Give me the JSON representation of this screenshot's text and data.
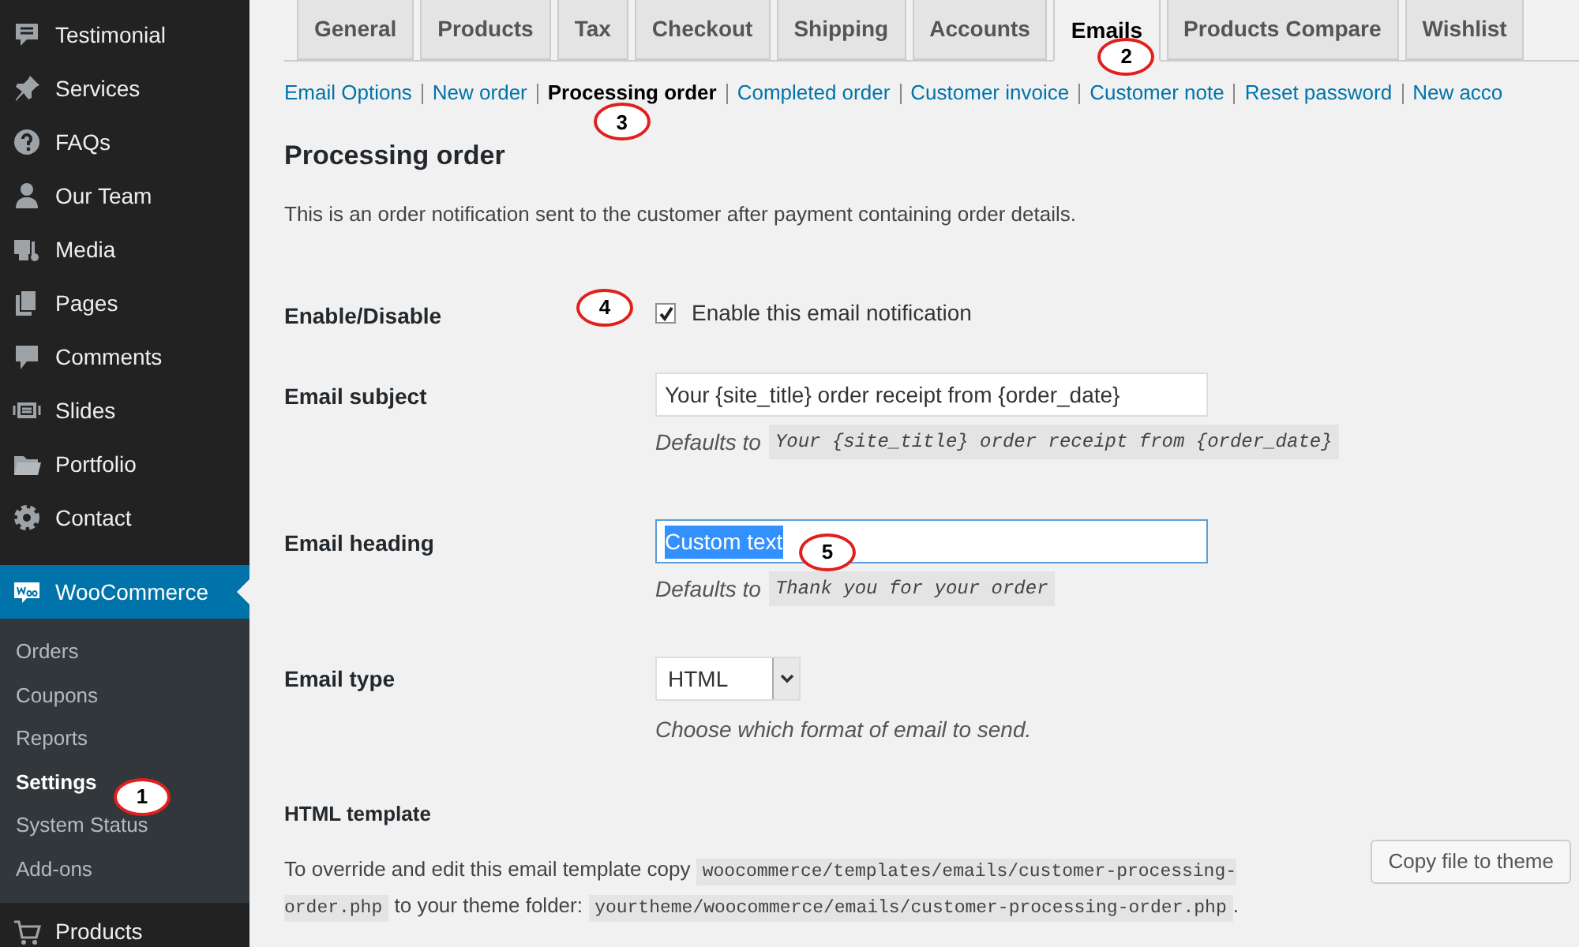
{
  "sidebar": {
    "items": [
      {
        "label": "Testimonial",
        "selected": false
      },
      {
        "label": "Services",
        "selected": false
      },
      {
        "label": "FAQs",
        "selected": false
      },
      {
        "label": "Our Team",
        "selected": false
      },
      {
        "label": "Media",
        "selected": false
      },
      {
        "label": "Pages",
        "selected": false
      },
      {
        "label": "Comments",
        "selected": false
      },
      {
        "label": "Slides",
        "selected": false
      },
      {
        "label": "Portfolio",
        "selected": false
      },
      {
        "label": "Contact",
        "selected": false
      },
      {
        "label": "WooCommerce",
        "selected": true,
        "children": [
          {
            "label": "Orders",
            "selected": false
          },
          {
            "label": "Coupons",
            "selected": false
          },
          {
            "label": "Reports",
            "selected": false
          },
          {
            "label": "Settings",
            "selected": true,
            "callout": "1"
          },
          {
            "label": "System Status",
            "selected": false
          },
          {
            "label": "Add-ons",
            "selected": false
          }
        ]
      },
      {
        "label": "Products",
        "selected": false
      }
    ]
  },
  "tabs": [
    {
      "label": "General",
      "selected": false
    },
    {
      "label": "Products",
      "selected": false
    },
    {
      "label": "Tax",
      "selected": false
    },
    {
      "label": "Checkout",
      "selected": false
    },
    {
      "label": "Shipping",
      "selected": false
    },
    {
      "label": "Accounts",
      "selected": false
    },
    {
      "label": "Emails",
      "selected": true,
      "callout": "2"
    },
    {
      "label": "Products Compare",
      "selected": false
    },
    {
      "label": "Wishlist",
      "selected": false
    }
  ],
  "subnav": [
    {
      "label": "Email Options",
      "selected": false
    },
    {
      "label": "New order",
      "selected": false
    },
    {
      "label": "Processing order",
      "selected": true,
      "callout": "3"
    },
    {
      "label": "Completed order",
      "selected": false
    },
    {
      "label": "Customer invoice",
      "selected": false
    },
    {
      "label": "Customer note",
      "selected": false
    },
    {
      "label": "Reset password",
      "selected": false
    },
    {
      "label": "New acco",
      "selected": false
    }
  ],
  "heading": "Processing order",
  "description": "This is an order notification sent to the customer after payment containing order details.",
  "fields": [
    {
      "kind": "checkbox",
      "label": "Enable/Disable",
      "text": "Enable this email notification",
      "checked": true,
      "callout": "4"
    },
    {
      "kind": "text",
      "label": "Email subject",
      "value": "Your {site_title} order receipt from {order_date}",
      "selected": false,
      "defaults_prefix": "Defaults to",
      "defaults": "Your {site_title} order receipt from {order_date}"
    },
    {
      "kind": "text",
      "label": "Email heading",
      "value": "Custom text",
      "selected": true,
      "callout": "5",
      "defaults_prefix": "Defaults to",
      "defaults": "Thank you for your order"
    },
    {
      "kind": "select",
      "label": "Email type",
      "value": "HTML",
      "hint": "Choose which format of email to send."
    }
  ],
  "template": {
    "title": "HTML template",
    "parts": [
      "To override and edit this email template copy ",
      "woocommerce/templates/emails/customer-processing-order.php",
      " to your theme folder: ",
      "yourtheme/woocommerce/emails/customer-processing-order.php",
      "."
    ],
    "button": "Copy file to theme"
  }
}
